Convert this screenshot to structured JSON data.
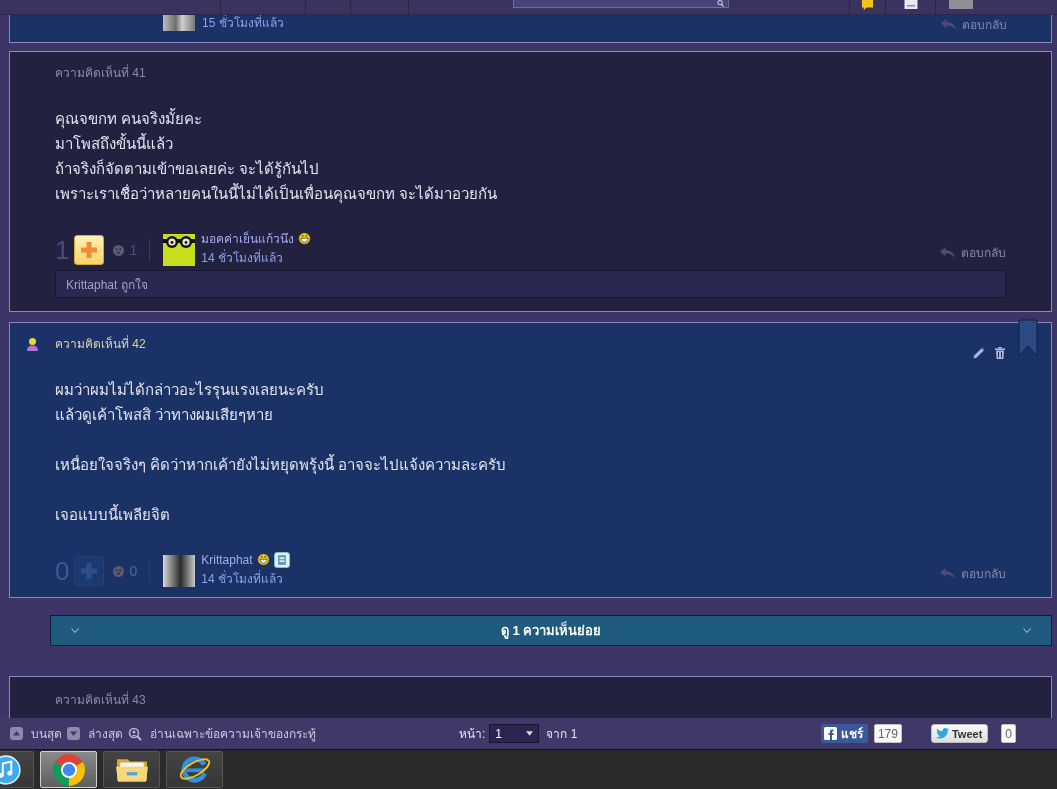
{
  "previous_comment": {
    "kind": "owner",
    "time": "15 ชั่วโมงที่แล้ว",
    "reply": "ตอบกลับ"
  },
  "comments": [
    {
      "kind": "reader",
      "label": "ความคิดเห็นที่ 41",
      "paragraphs": [
        [
          "คุณจขกท คนจริงมั้ยคะ",
          "มาโพสถึงขั้นนี้แล้ว",
          "ถ้าจริงก็จัดตามเข้าขอเลยค่ะ จะได้รู้กันไป",
          "เพราะเราเชื่อว่าหลายคนในนี้ไม่ได้เป็นเพื่อนคุณจขกท จะได้มาอวยกัน"
        ]
      ],
      "score": "1",
      "liked": true,
      "reaction_count": "1",
      "avatar": {
        "kind": "cartoon"
      },
      "author": "มอคค่าเย็นแก้วนึง",
      "time": "14 ชั่วโมงที่แล้ว",
      "reply": "ตอบกลับ",
      "likes": "Krittaphat ถูกใจ"
    },
    {
      "kind": "owner",
      "label": "ความคิดเห็นที่ 42",
      "paragraphs": [
        [
          "ผมว่าผมไม่ได้กล่าวอะไรรุนแรงเลยนะครับ",
          "แล้วดูเค้าโพสสิ ว่าทางผมเสียๆหาย"
        ],
        [
          "เหนื่อยใจจริงๆ คิดว่าหากเค้ายังไม่หยุดพรุ้งนี้ อาจจะไปแจ้งความละครับ"
        ],
        [
          "เจอแบบนี้เพลียจิต"
        ]
      ],
      "score": "0",
      "liked": false,
      "reaction_count": "0",
      "avatar": {
        "kind": "photo"
      },
      "author": "Krittaphat",
      "member_badge": true,
      "time": "14 ชั่วโมงที่แล้ว",
      "reply": "ตอบกลับ",
      "replies_toggle": "ดู 1 ความเห็นย่อย"
    }
  ],
  "next_comment": {
    "kind": "reader",
    "label": "ความคิดเห็นที่ 43"
  },
  "toolbar": {
    "top": "บนสุด",
    "bottom": "ล่างสุด",
    "owner_only": "อ่านเฉพาะข้อความเจ้าของกระทู้",
    "page_label": "หน้า:",
    "page_select": "1",
    "page_total": "จาก 1",
    "share": {
      "label": "แชร์",
      "count": "179"
    },
    "tweet": {
      "label": "Tweet",
      "count": "0"
    }
  },
  "taskbar": {
    "apps": [
      {
        "kind": "media",
        "selected": false
      },
      {
        "kind": "browser",
        "selected": true
      },
      {
        "kind": "folder",
        "selected": false
      },
      {
        "kind": "explorer",
        "selected": false
      }
    ]
  }
}
